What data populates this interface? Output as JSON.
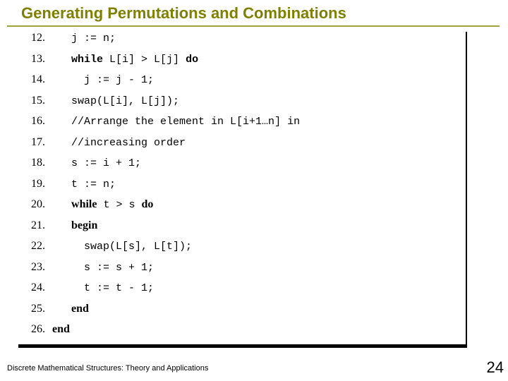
{
  "title": "Generating Permutations and Combinations",
  "footer_left": "Discrete Mathematical Structures: Theory and Applications",
  "page_number": "24",
  "lines": {
    "n12": "12.",
    "c12a": "j := n;",
    "n13": "13.",
    "c13a": "while",
    "c13b": " L[i] > L[j] ",
    "c13c": "do",
    "n14": "14.",
    "c14a": "  j := j - 1;",
    "n15": "15.",
    "c15a": "swap(L[i], L[j]);",
    "n16": "16.",
    "c16a": "//Arrange the element in L[i+1…n] in",
    "n17": "17.",
    "c17a": "//increasing order",
    "n18": "18.",
    "c18a": "s := i + 1;",
    "n19": "19.",
    "c19a": "t := n;",
    "n20": "20.",
    "c20a": "while",
    "c20b": " t > s ",
    "c20c": "do",
    "n21": "21.",
    "c21a": "begin",
    "n22": "22.",
    "c22a": "  swap(L[s], L[t]);",
    "n23": "23.",
    "c23a": "  s := s + 1;",
    "n24": "24.",
    "c24a": "  t := t - 1;",
    "n25": "25.",
    "c25a": "end",
    "n26": "26.",
    "c26a": "end"
  }
}
